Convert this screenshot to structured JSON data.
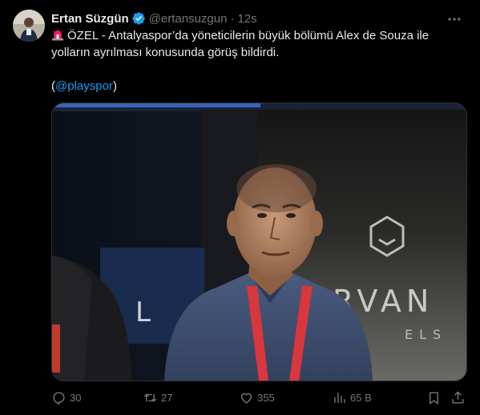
{
  "tweet": {
    "author_name": "Ertan Süzgün",
    "handle": "@ertansuzgun",
    "separator": "·",
    "time": "12s",
    "body_line1": "ÖZEL - Antalyaspor’da yöneticilerin büyük bölümü Alex de Souza ile",
    "body_line2": "yolların ayrılması konusunda görüş bildirdi.",
    "paren_open": "(",
    "mention": "@playspor",
    "paren_close": ")",
    "icons": {
      "verified": "verified-badge-icon",
      "more": "more-horizontal-icon",
      "siren": "police-siren-emoji"
    }
  },
  "media": {
    "sign_letters": "RVAN",
    "sign_sub": "ELS",
    "sign_left": "L"
  },
  "actions": {
    "replies": "30",
    "reposts": "27",
    "likes": "355",
    "views": "65 B"
  },
  "colors": {
    "background": "#000000",
    "text": "#e7e9ea",
    "muted": "#71767b",
    "accent": "#1d9bf0"
  }
}
